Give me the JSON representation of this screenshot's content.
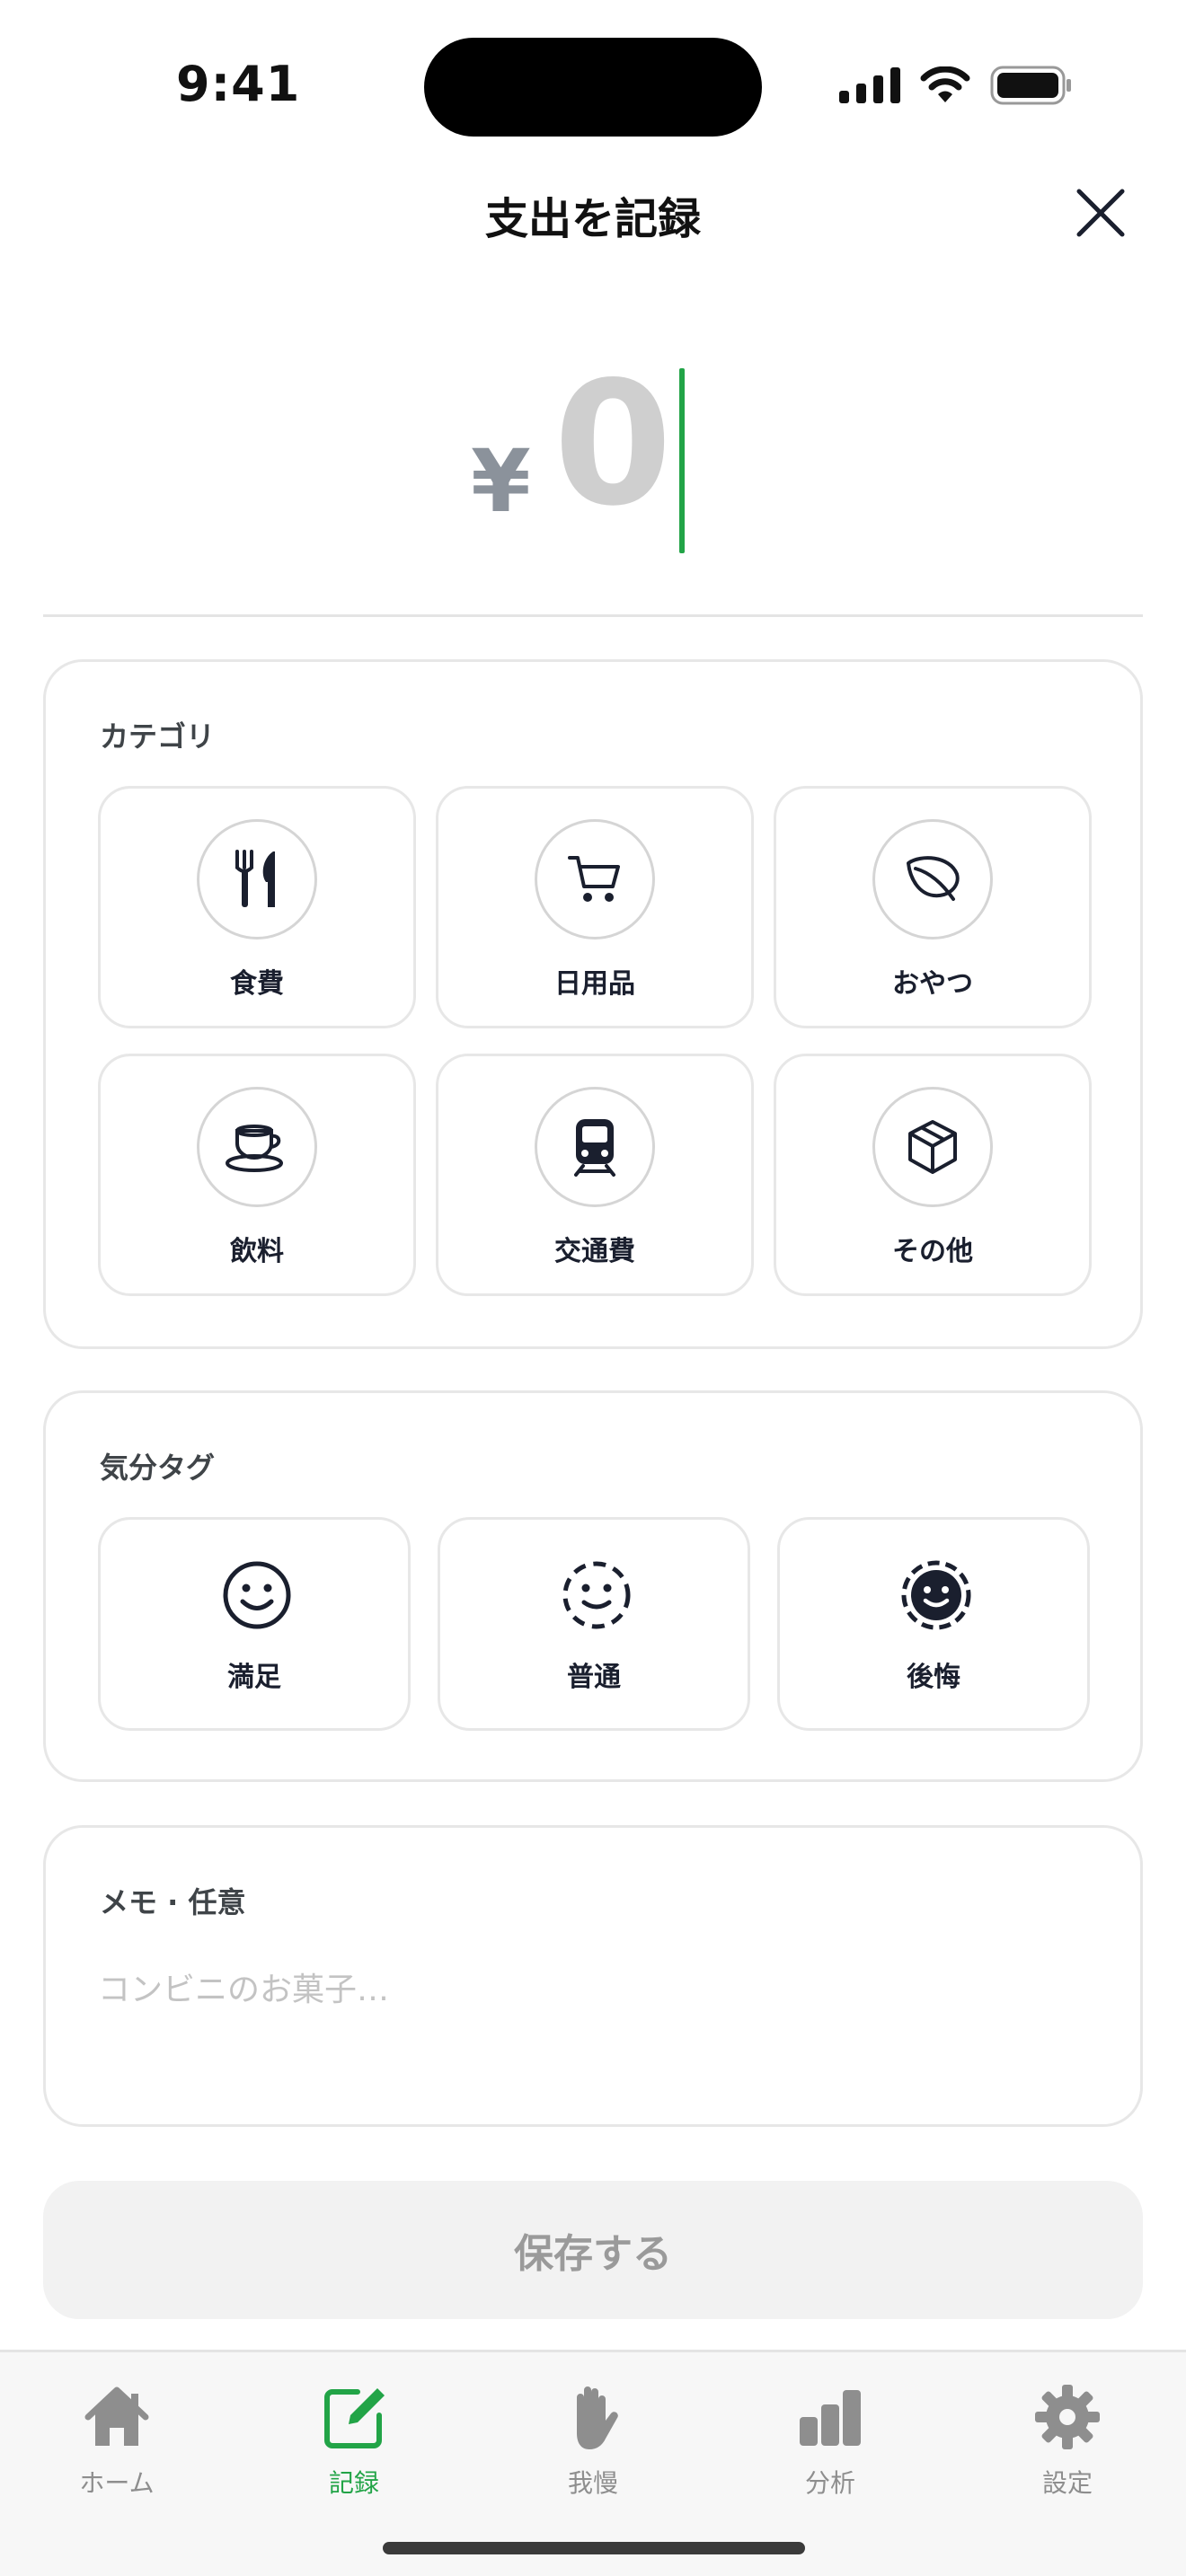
{
  "status_bar": {
    "time": "9:41"
  },
  "header": {
    "title": "支出を記録"
  },
  "amount": {
    "currency": "¥",
    "value": "0"
  },
  "category": {
    "title": "カテゴリ",
    "items": [
      {
        "label": "食費",
        "icon": "fork-knife-icon"
      },
      {
        "label": "日用品",
        "icon": "cart-icon"
      },
      {
        "label": "おやつ",
        "icon": "leaf-icon"
      },
      {
        "label": "飲料",
        "icon": "cup-icon"
      },
      {
        "label": "交通費",
        "icon": "train-icon"
      },
      {
        "label": "その他",
        "icon": "box-icon"
      }
    ]
  },
  "mood": {
    "title": "気分タグ",
    "items": [
      {
        "label": "満足",
        "icon": "smile-icon"
      },
      {
        "label": "普通",
        "icon": "neutral-face-icon"
      },
      {
        "label": "後悔",
        "icon": "regret-face-icon"
      }
    ]
  },
  "memo": {
    "title": "メモ · 任意",
    "placeholder": "コンビニのお菓子…",
    "value": ""
  },
  "save": {
    "label": "保存する"
  },
  "tabs": [
    {
      "label": "ホーム",
      "icon": "home-icon",
      "active": false
    },
    {
      "label": "記録",
      "icon": "edit-icon",
      "active": true
    },
    {
      "label": "我慢",
      "icon": "hand-icon",
      "active": false
    },
    {
      "label": "分析",
      "icon": "bar-chart-icon",
      "active": false
    },
    {
      "label": "設定",
      "icon": "gear-icon",
      "active": false
    }
  ],
  "colors": {
    "accent": "#22a447",
    "text": "#1a1f2e",
    "muted": "#8e8e8e"
  }
}
